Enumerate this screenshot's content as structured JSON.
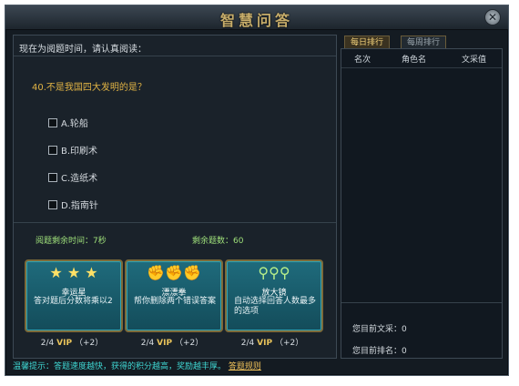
{
  "window": {
    "title": "智慧问答"
  },
  "left": {
    "notice": "现在为阅题时间，请认真阅读：",
    "question": "40.不是我国四大发明的是？",
    "options": [
      "A.轮船",
      "B.印刷术",
      "C.造纸术",
      "D.指南针"
    ],
    "time_left_label": "阅题剩余时间：",
    "time_left_value": "7秒",
    "remaining_label": "剩余题数：",
    "remaining_value": "60"
  },
  "powerups": [
    {
      "name": "幸运星",
      "desc": "答对题后分数将乘以2",
      "icon": "star-icon",
      "vip": "2/4",
      "vip_label": "VIP",
      "vip_bonus": "（+2）"
    },
    {
      "name": "漂漂拳",
      "desc": "帮你删除两个错误答案",
      "icon": "fist-icon",
      "vip": "2/4",
      "vip_label": "VIP",
      "vip_bonus": "（+2）"
    },
    {
      "name": "放大镜",
      "desc": "自动选择回答人数最多的选项",
      "icon": "magnifier-icon",
      "vip": "2/4",
      "vip_label": "VIP",
      "vip_bonus": "（+2）"
    }
  ],
  "tip": {
    "text": "温馨提示：答题速度越快，获得的积分越高，奖励越丰厚。",
    "link": "答题规则"
  },
  "ranking": {
    "tabs": [
      "每日排行",
      "每周排行"
    ],
    "headers": [
      "名次",
      "角色名",
      "文采值"
    ],
    "my_score_label": "您目前文采：",
    "my_score_value": "0",
    "my_rank_label": "您目前排名：",
    "my_rank_value": "0"
  },
  "colors": {
    "gold": "#e0b344",
    "green": "#9fe07a",
    "cyan": "#3fd6d2",
    "card": "#1f6b7c"
  }
}
